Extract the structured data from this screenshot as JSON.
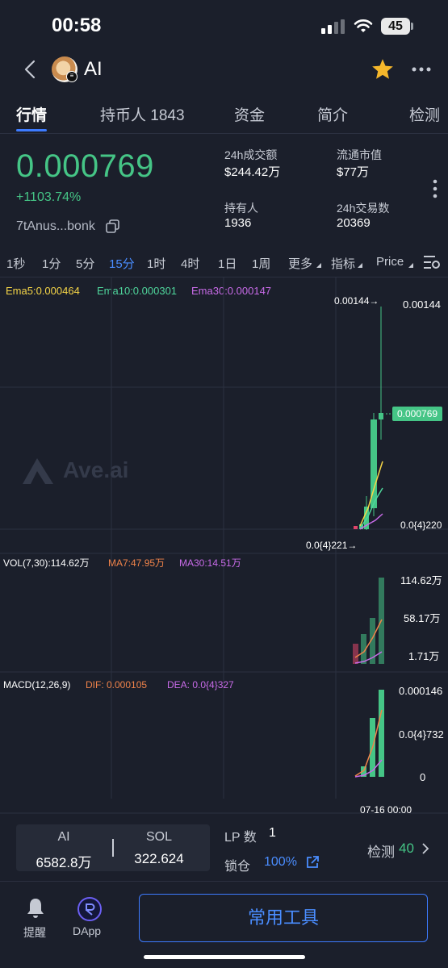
{
  "status": {
    "time": "00:58",
    "battery": "45"
  },
  "header": {
    "name": "AI"
  },
  "tabs": [
    {
      "label": "行情"
    },
    {
      "label": "持币人 1843"
    },
    {
      "label": "资金"
    },
    {
      "label": "简介"
    },
    {
      "label": "检测"
    }
  ],
  "price": {
    "value": "0.000769",
    "change": "+1103.74%",
    "address": "7tAnus...bonk",
    "stats": {
      "vol_label": "24h成交额",
      "vol_value": "$244.42万",
      "mcap_label": "流通市值",
      "mcap_value": "$77万",
      "holders_label": "持有人",
      "holders_value": "1936",
      "tx_label": "24h交易数",
      "tx_value": "20369"
    }
  },
  "timeframes": [
    "1秒",
    "1分",
    "5分",
    "15分",
    "1时",
    "4时",
    "1日",
    "1周",
    "更多",
    "指标",
    "Price"
  ],
  "active_timeframe": "15分",
  "chart": {
    "ema5": "Ema5:0.000464",
    "ema10": "Ema10:0.000301",
    "ema30": "Ema30:0.000147",
    "watermark": "Ave.ai",
    "high_marker": "0.00144→",
    "low_marker": "0.0{4}221→",
    "axis_top": "0.00144",
    "axis_current": "0.000769",
    "axis_bottom": "0.0{4}220",
    "vol_label": "VOL(7,30):114.62万",
    "vol_ma7": "MA7:47.95万",
    "vol_ma30": "MA30:14.51万",
    "vol_axis": [
      "114.62万",
      "58.17万",
      "1.71万"
    ],
    "macd_label": "MACD(12,26,9)",
    "macd_dif": "DIF: 0.000105",
    "macd_dea": "DEA: 0.0{4}327",
    "macd_axis": [
      "0.000146",
      "0.0{4}732",
      "0"
    ],
    "date_label": "07-16 00:00",
    "colors": {
      "up": "#45c586",
      "down": "#e0456a",
      "ema5": "#f5d547",
      "ema10": "#4fd69c",
      "ema30": "#c86be8",
      "ma7": "#f0834a",
      "ma30": "#c86be8",
      "dif": "#f0834a",
      "dea": "#c86be8"
    }
  },
  "bottom": {
    "pair_left_label": "AI",
    "pair_left_value": "6582.8万",
    "pair_right_label": "SOL",
    "pair_right_value": "322.624",
    "lp_label": "LP 数",
    "lp_value": "1",
    "lock_label": "锁仓",
    "lock_value": "100%",
    "check_label": "检测",
    "check_value": "40"
  },
  "footer": {
    "alert_label": "提醒",
    "dapp_label": "DApp",
    "tools_label": "常用工具"
  }
}
